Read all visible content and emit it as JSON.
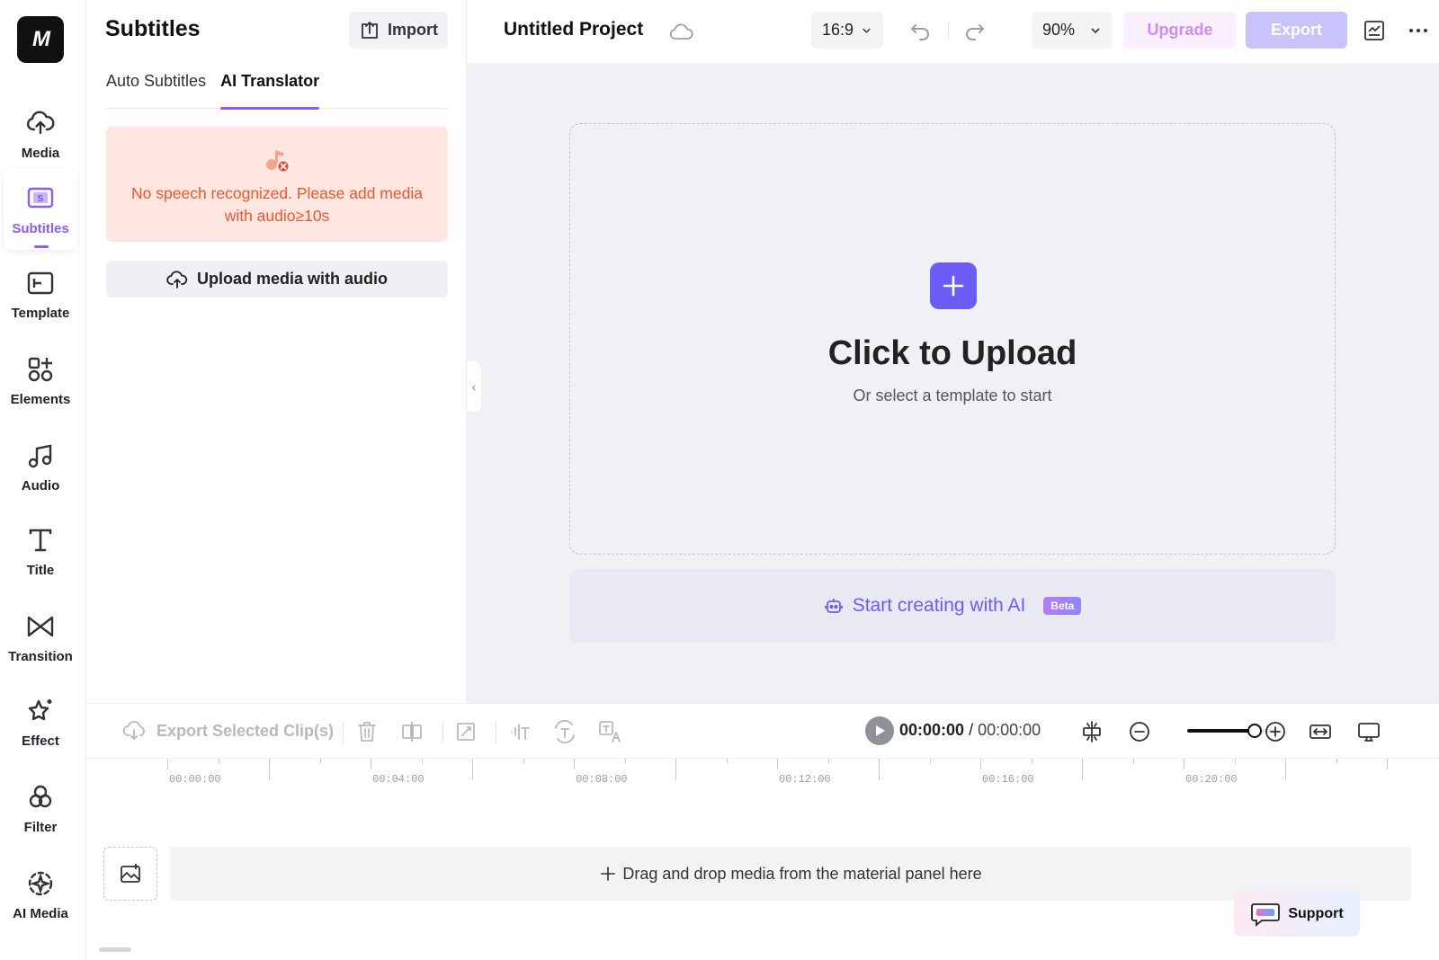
{
  "logo": {
    "text": "M"
  },
  "rail": {
    "items": [
      {
        "label": "Media",
        "icon": "cloud-upload-icon"
      },
      {
        "label": "Subtitles",
        "icon": "subtitles-icon",
        "active": true
      },
      {
        "label": "Template",
        "icon": "template-icon"
      },
      {
        "label": "Elements",
        "icon": "elements-icon"
      },
      {
        "label": "Audio",
        "icon": "music-note-icon"
      },
      {
        "label": "Title",
        "icon": "text-t-icon"
      },
      {
        "label": "Transition",
        "icon": "transition-icon"
      },
      {
        "label": "Effect",
        "icon": "sparkle-star-icon"
      },
      {
        "label": "Filter",
        "icon": "filter-circles-icon"
      },
      {
        "label": "AI Media",
        "icon": "ai-sparkle-icon"
      }
    ]
  },
  "panel": {
    "title": "Subtitles",
    "import_label": "Import",
    "tabs": [
      {
        "label": "Auto Subtitles",
        "active": false
      },
      {
        "label": "AI Translator",
        "active": true
      }
    ],
    "warning": "No speech recognized. Please add media with audio≥10s",
    "upload_label": "Upload media with audio"
  },
  "header": {
    "project_title": "Untitled Project",
    "aspect_ratio": "16:9",
    "zoom": "90%",
    "upgrade_label": "Upgrade",
    "export_label": "Export"
  },
  "canvas": {
    "upload_title": "Click to Upload",
    "upload_subtitle": "Or select a template to start",
    "ai_label": "Start creating with AI",
    "beta_label": "Beta"
  },
  "timeline": {
    "export_clips_label": "Export Selected Clip(s)",
    "current_time": "00:00:00",
    "separator": "/",
    "total_time": "00:00:00",
    "zoom_level": 0.75,
    "ruler_labels": [
      "00:00:00",
      "00:04:00",
      "00:08:00",
      "00:12:00",
      "00:16:00",
      "00:20:00"
    ],
    "drop_hint": "Drag and drop media from the material panel here"
  },
  "support": {
    "label": "Support"
  },
  "colors": {
    "accent": "#8b5cf6",
    "primary": "#6b5cf6",
    "warning_bg": "#fee7e1",
    "warning_text": "#f5562d",
    "export_disabled": "#c9c3fb",
    "upgrade_text": "#d18bf1"
  }
}
